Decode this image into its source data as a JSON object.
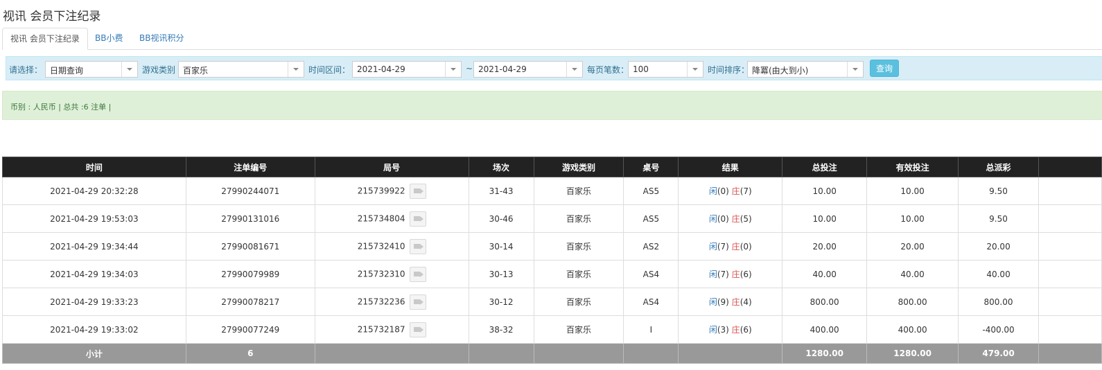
{
  "page_title": "视讯 会员下注纪录",
  "tabs": [
    {
      "label": "视讯 会员下注纪录",
      "active": true
    },
    {
      "label": "BB小费",
      "active": false
    },
    {
      "label": "BB视讯积分",
      "active": false
    }
  ],
  "filters": {
    "select_label": "请选择：",
    "select_value": "日期查询",
    "game_label": "游戏类别",
    "game_value": "百家乐",
    "time_label": "时间区间：",
    "date_from": "2021-04-29",
    "range_sep": "~",
    "date_to": "2021-04-29",
    "page_size_label": "每页笔数：",
    "page_size_value": "100",
    "sort_label": "时间排序：",
    "sort_value": "降冪(由大到小)",
    "query_label": "查询"
  },
  "summary": "币别 : 人民币 | 总共 :6 注单 |",
  "table": {
    "headers": [
      "时间",
      "注单编号",
      "局号",
      "场次",
      "游戏类别",
      "桌号",
      "结果",
      "总投注",
      "有效投注",
      "总派彩",
      ""
    ],
    "rows": [
      {
        "time": "2021-04-29 20:32:28",
        "bet_no": "27990244071",
        "round": "215739922",
        "session": "31-43",
        "game": "百家乐",
        "table": "AS5",
        "player_label": "闲",
        "player_score": "(0)",
        "banker_label": "庄",
        "banker_score": "(7)",
        "total_bet": "10.00",
        "valid_bet": "10.00",
        "payout": "9.50",
        "payout_negative": false
      },
      {
        "time": "2021-04-29 19:53:03",
        "bet_no": "27990131016",
        "round": "215734804",
        "session": "30-46",
        "game": "百家乐",
        "table": "AS5",
        "player_label": "闲",
        "player_score": "(0)",
        "banker_label": "庄",
        "banker_score": "(5)",
        "total_bet": "10.00",
        "valid_bet": "10.00",
        "payout": "9.50",
        "payout_negative": false
      },
      {
        "time": "2021-04-29 19:34:44",
        "bet_no": "27990081671",
        "round": "215732410",
        "session": "30-14",
        "game": "百家乐",
        "table": "AS2",
        "player_label": "闲",
        "player_score": "(7)",
        "banker_label": "庄",
        "banker_score": "(0)",
        "total_bet": "20.00",
        "valid_bet": "20.00",
        "payout": "20.00",
        "payout_negative": false
      },
      {
        "time": "2021-04-29 19:34:03",
        "bet_no": "27990079989",
        "round": "215732310",
        "session": "30-13",
        "game": "百家乐",
        "table": "AS4",
        "player_label": "闲",
        "player_score": "(7)",
        "banker_label": "庄",
        "banker_score": "(6)",
        "total_bet": "40.00",
        "valid_bet": "40.00",
        "payout": "40.00",
        "payout_negative": false
      },
      {
        "time": "2021-04-29 19:33:23",
        "bet_no": "27990078217",
        "round": "215732236",
        "session": "30-12",
        "game": "百家乐",
        "table": "AS4",
        "player_label": "闲",
        "player_score": "(9)",
        "banker_label": "庄",
        "banker_score": "(4)",
        "total_bet": "800.00",
        "valid_bet": "800.00",
        "payout": "800.00",
        "payout_negative": false
      },
      {
        "time": "2021-04-29 19:33:02",
        "bet_no": "27990077249",
        "round": "215732187",
        "session": "38-32",
        "game": "百家乐",
        "table": "I",
        "player_label": "闲",
        "player_score": "(3)",
        "banker_label": "庄",
        "banker_score": "(6)",
        "total_bet": "400.00",
        "valid_bet": "400.00",
        "payout": "-400.00",
        "payout_negative": true
      }
    ],
    "subtotal": {
      "label": "小计",
      "count": "6",
      "total_bet": "1280.00",
      "valid_bet": "1280.00",
      "payout": "479.00"
    }
  },
  "colors": {
    "header_bg": "#222222",
    "link_blue": "#337ab7",
    "negative_red": "#d9534f",
    "subtotal_bg": "#999999",
    "filter_bg": "#d9edf7",
    "summary_bg": "#dff0d8"
  }
}
